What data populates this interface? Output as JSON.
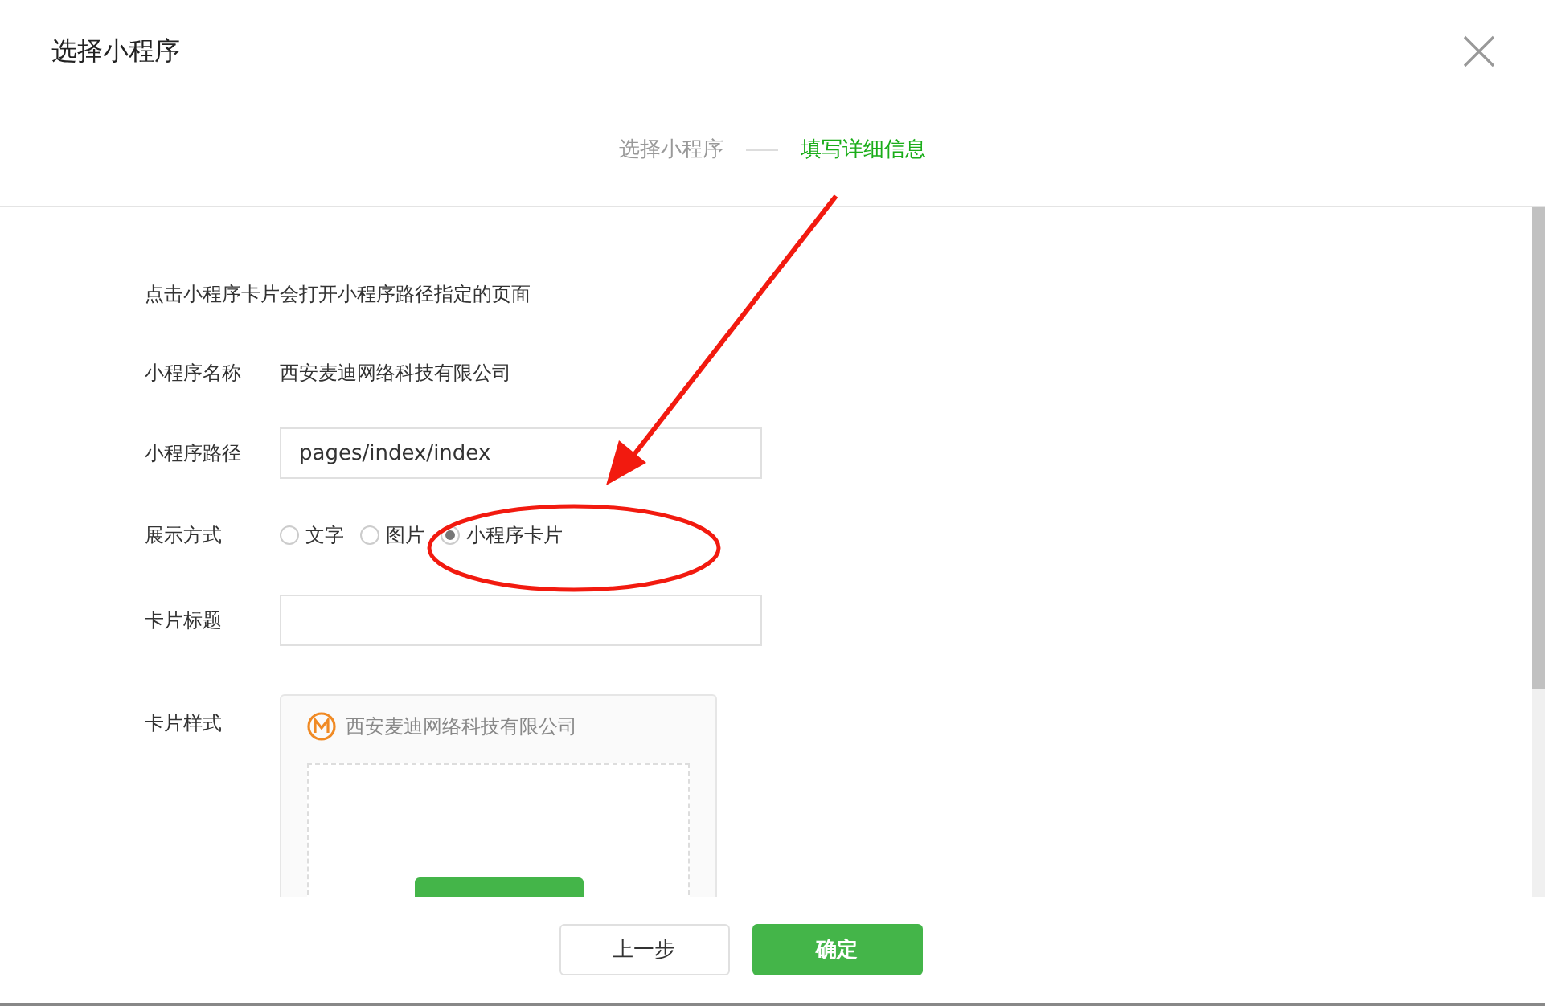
{
  "dialog": {
    "title": "选择小程序"
  },
  "steps": [
    {
      "label": "选择小程序",
      "selected": false
    },
    {
      "label": "填写详细信息",
      "selected": true
    }
  ],
  "form": {
    "intro": "点击小程序卡片会打开小程序路径指定的页面",
    "name_label": "小程序名称",
    "name_value": "西安麦迪网络科技有限公司",
    "path_label": "小程序路径",
    "path_value": "pages/index/index",
    "display_label": "展示方式",
    "display_options": [
      {
        "label": "文字",
        "selected": false
      },
      {
        "label": "图片",
        "selected": false
      },
      {
        "label": "小程序卡片",
        "selected": true
      }
    ],
    "title_label": "卡片标题",
    "style_label": "卡片样式",
    "card": {
      "name": "西安麦迪网络科技有限公司"
    }
  },
  "buttons": [
    {
      "label": "上一步",
      "kind": "secondary"
    },
    {
      "label": "确定",
      "kind": "primary"
    }
  ]
}
